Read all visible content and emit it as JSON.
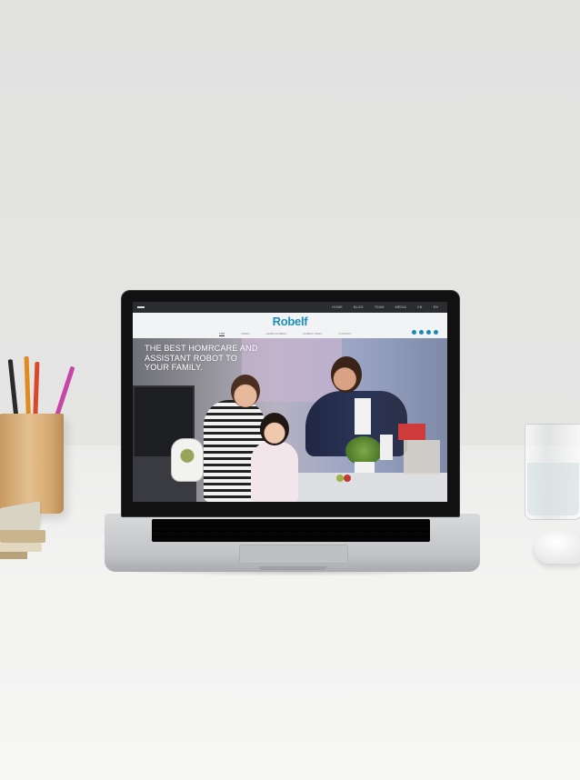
{
  "website": {
    "nav": [
      "HOME",
      "BLOG",
      "TEAM",
      "MEDIA",
      "CN",
      "EN"
    ],
    "logo": "Robelf",
    "subnav": [
      "TOP",
      "VIDEO",
      "LEARN ROBELF",
      "ROBELF SPEC",
      "CONTACT"
    ],
    "hero_lines": [
      "THE BEST HOMRCARE AND",
      "ASSISTANT ROBOT TO",
      "YOUR FAMILY."
    ],
    "brand_color": "#1d8fb8"
  }
}
